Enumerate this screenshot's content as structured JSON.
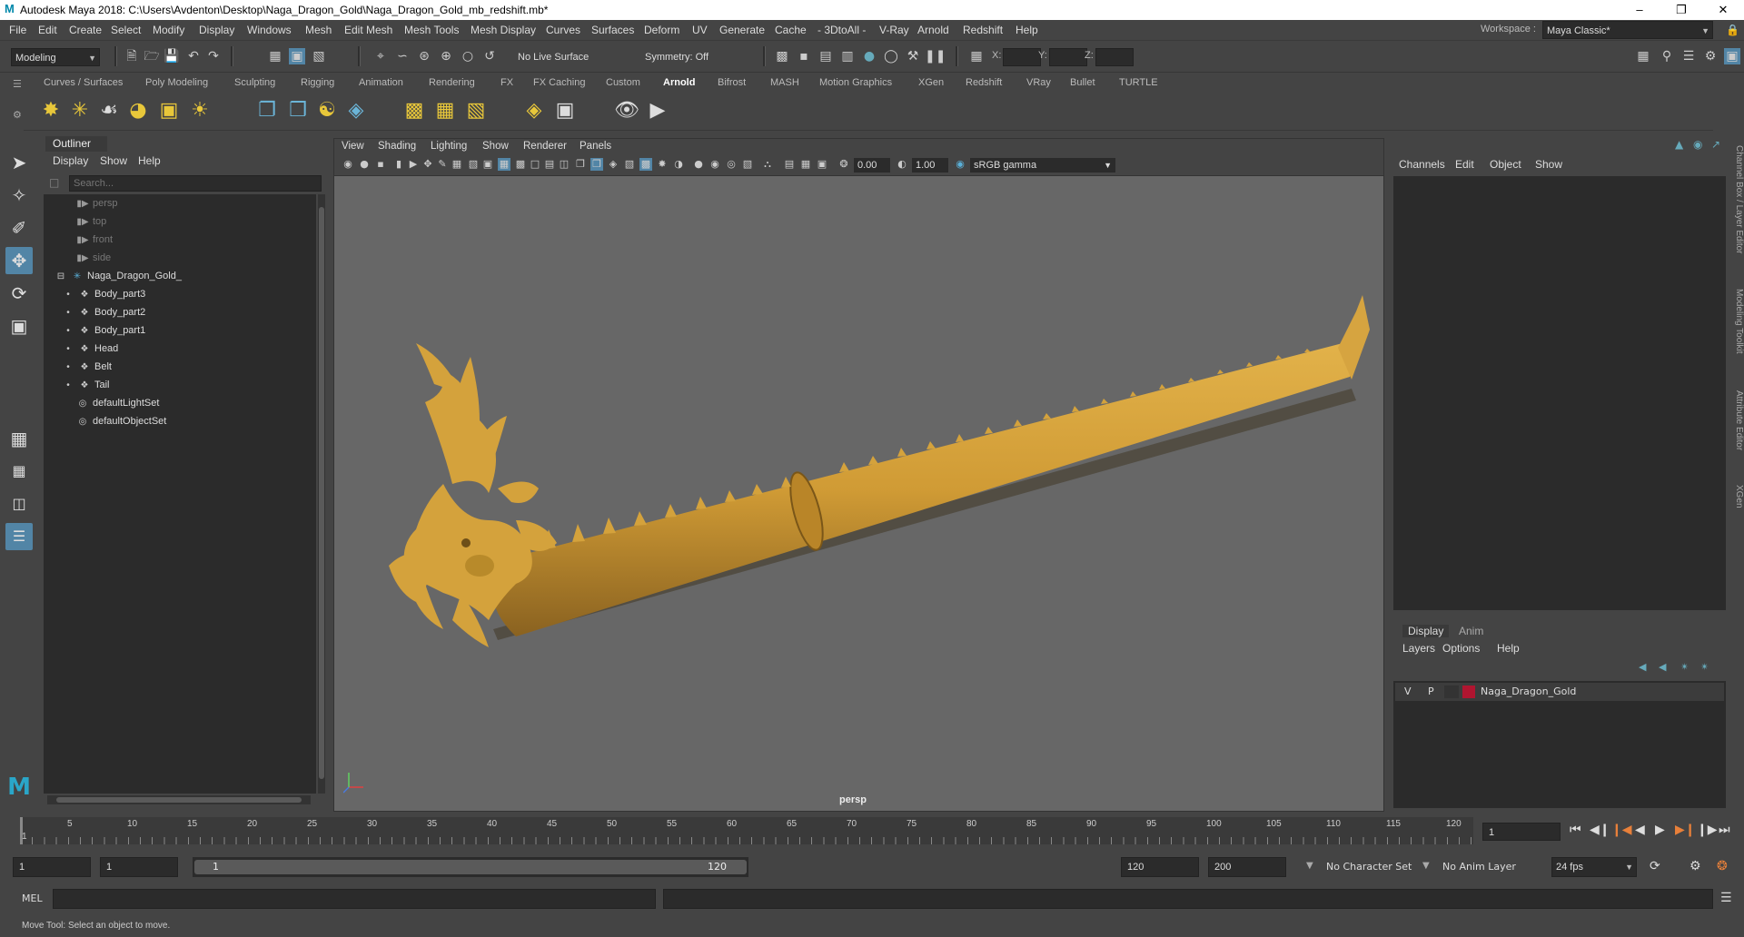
{
  "window": {
    "title": "Autodesk Maya 2018: C:\\Users\\Avdenton\\Desktop\\Naga_Dragon_Gold\\Naga_Dragon_Gold_mb_redshift.mb*",
    "logo_letter": "M"
  },
  "menubar": {
    "items": [
      "File",
      "Edit",
      "Create",
      "Select",
      "Modify",
      "Display",
      "Windows",
      "Mesh",
      "Edit Mesh",
      "Mesh Tools",
      "Mesh Display",
      "Curves",
      "Surfaces",
      "Deform",
      "UV",
      "Generate",
      "Cache",
      "- 3DtoAll -",
      "V-Ray",
      "Arnold",
      "Redshift",
      "Help"
    ],
    "workspace_label": "Workspace :",
    "workspace_value": "Maya Classic*"
  },
  "statusline": {
    "mode": "Modeling",
    "live_surface": "No Live Surface",
    "symmetry": "Symmetry: Off",
    "x_label": "X:",
    "y_label": "Y:",
    "z_label": "Z:"
  },
  "shelf": {
    "tabs": [
      "Curves / Surfaces",
      "Poly Modeling",
      "Sculpting",
      "Rigging",
      "Animation",
      "Rendering",
      "FX",
      "FX Caching",
      "Custom",
      "Arnold",
      "Bifrost",
      "MASH",
      "Motion Graphics",
      "XGen",
      "Redshift",
      "VRay",
      "Bullet",
      "TURTLE"
    ],
    "active_tab": "Arnold"
  },
  "outliner": {
    "title": "Outliner",
    "menu": [
      "Display",
      "Show",
      "Help"
    ],
    "search_placeholder": "Search...",
    "items": [
      {
        "label": "persp",
        "icon": "camera-icon",
        "dim": true,
        "indent": 0
      },
      {
        "label": "top",
        "icon": "camera-icon",
        "dim": true,
        "indent": 0
      },
      {
        "label": "front",
        "icon": "camera-icon",
        "dim": true,
        "indent": 0
      },
      {
        "label": "side",
        "icon": "camera-icon",
        "dim": true,
        "indent": 0
      },
      {
        "label": "Naga_Dragon_Gold_",
        "icon": "group-icon",
        "dim": false,
        "indent": 0
      },
      {
        "label": "Body_part3",
        "icon": "mesh-icon",
        "dim": false,
        "indent": 1
      },
      {
        "label": "Body_part2",
        "icon": "mesh-icon",
        "dim": false,
        "indent": 1
      },
      {
        "label": "Body_part1",
        "icon": "mesh-icon",
        "dim": false,
        "indent": 1
      },
      {
        "label": "Head",
        "icon": "mesh-icon",
        "dim": false,
        "indent": 1
      },
      {
        "label": "Belt",
        "icon": "mesh-icon",
        "dim": false,
        "indent": 1
      },
      {
        "label": "Tail",
        "icon": "mesh-icon",
        "dim": false,
        "indent": 1
      },
      {
        "label": "defaultLightSet",
        "icon": "set-icon",
        "dim": false,
        "indent": 0
      },
      {
        "label": "defaultObjectSet",
        "icon": "set-icon",
        "dim": false,
        "indent": 0
      }
    ]
  },
  "viewport": {
    "menu": [
      "View",
      "Shading",
      "Lighting",
      "Show",
      "Renderer",
      "Panels"
    ],
    "exposure": "0.00",
    "gamma": "1.00",
    "colorspace": "sRGB gamma",
    "camera": "persp",
    "model_color": "#d4a23c"
  },
  "channelbox": {
    "menu": [
      "Channels",
      "Edit",
      "Object",
      "Show"
    ],
    "layer_tabs": [
      "Display",
      "Anim"
    ],
    "layer_menu": [
      "Layers",
      "Options",
      "Help"
    ],
    "layer": {
      "v": "V",
      "p": "P",
      "name": "Naga_Dragon_Gold",
      "color": "#b01530"
    },
    "side_tabs": [
      "Channel Box / Layer Editor",
      "Modeling Toolkit",
      "Attribute Editor",
      "XGen"
    ]
  },
  "timeline": {
    "ticks": [
      "1",
      "5",
      "10",
      "15",
      "20",
      "25",
      "30",
      "35",
      "40",
      "45",
      "50",
      "55",
      "60",
      "65",
      "70",
      "75",
      "80",
      "85",
      "90",
      "95",
      "100",
      "105",
      "110",
      "115",
      "120"
    ],
    "current_frame": "1"
  },
  "range": {
    "start": "1",
    "playback_start": "1",
    "slider_start": "1",
    "slider_end": "120",
    "playback_end": "120",
    "end": "200",
    "character_set": "No Character Set",
    "anim_layer": "No Anim Layer",
    "fps": "24 fps"
  },
  "cmdline": {
    "label": "MEL"
  },
  "helpline": {
    "text": "Move Tool: Select an object to move."
  }
}
